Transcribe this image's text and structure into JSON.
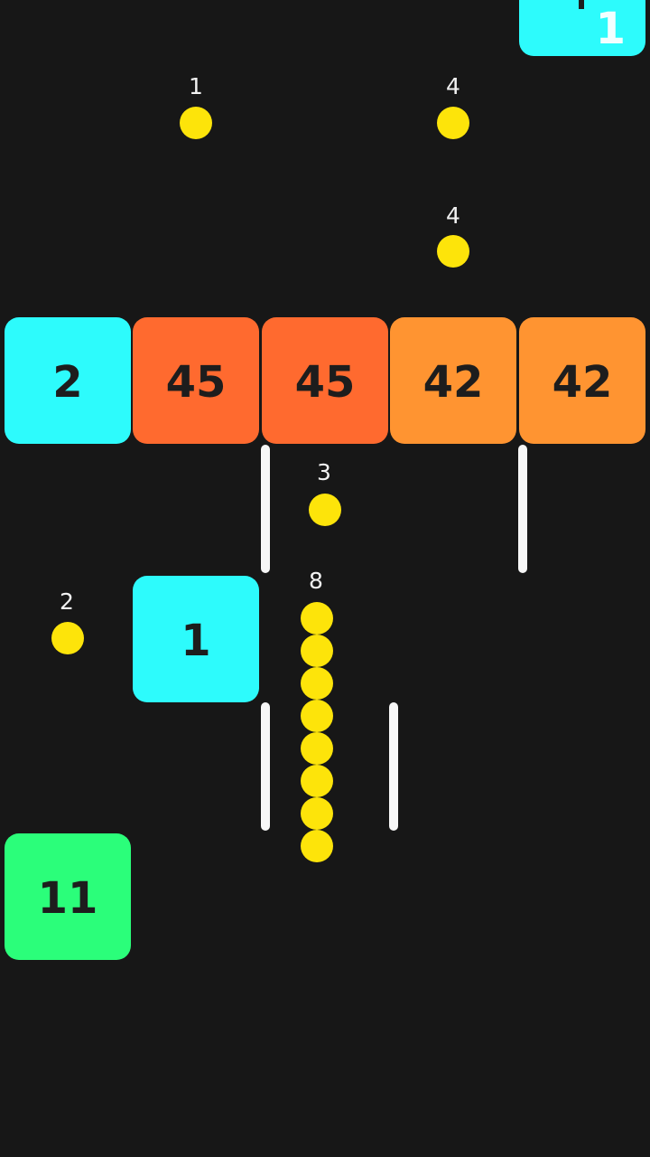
{
  "game": {
    "top_block": {
      "value": "1",
      "color": "cyan"
    },
    "block_row": [
      {
        "value": "2",
        "color": "cyan"
      },
      {
        "value": "45",
        "color": "red-orange"
      },
      {
        "value": "45",
        "color": "red-orange"
      },
      {
        "value": "42",
        "color": "orange"
      },
      {
        "value": "42",
        "color": "orange"
      }
    ],
    "blocks": [
      {
        "value": "1",
        "color": "cyan"
      },
      {
        "value": "11",
        "color": "green"
      }
    ],
    "pickups": [
      "1",
      "4",
      "4",
      "3",
      "2"
    ],
    "snake": {
      "length": "8",
      "segments": 8
    },
    "colors": {
      "background": "#171717",
      "cyan": "#2dfbfc",
      "red-orange": "#ff6a2f",
      "orange": "#ff9431",
      "green": "#2bfe7a",
      "ball": "#fde40a",
      "wall": "#f7f7f7"
    }
  }
}
